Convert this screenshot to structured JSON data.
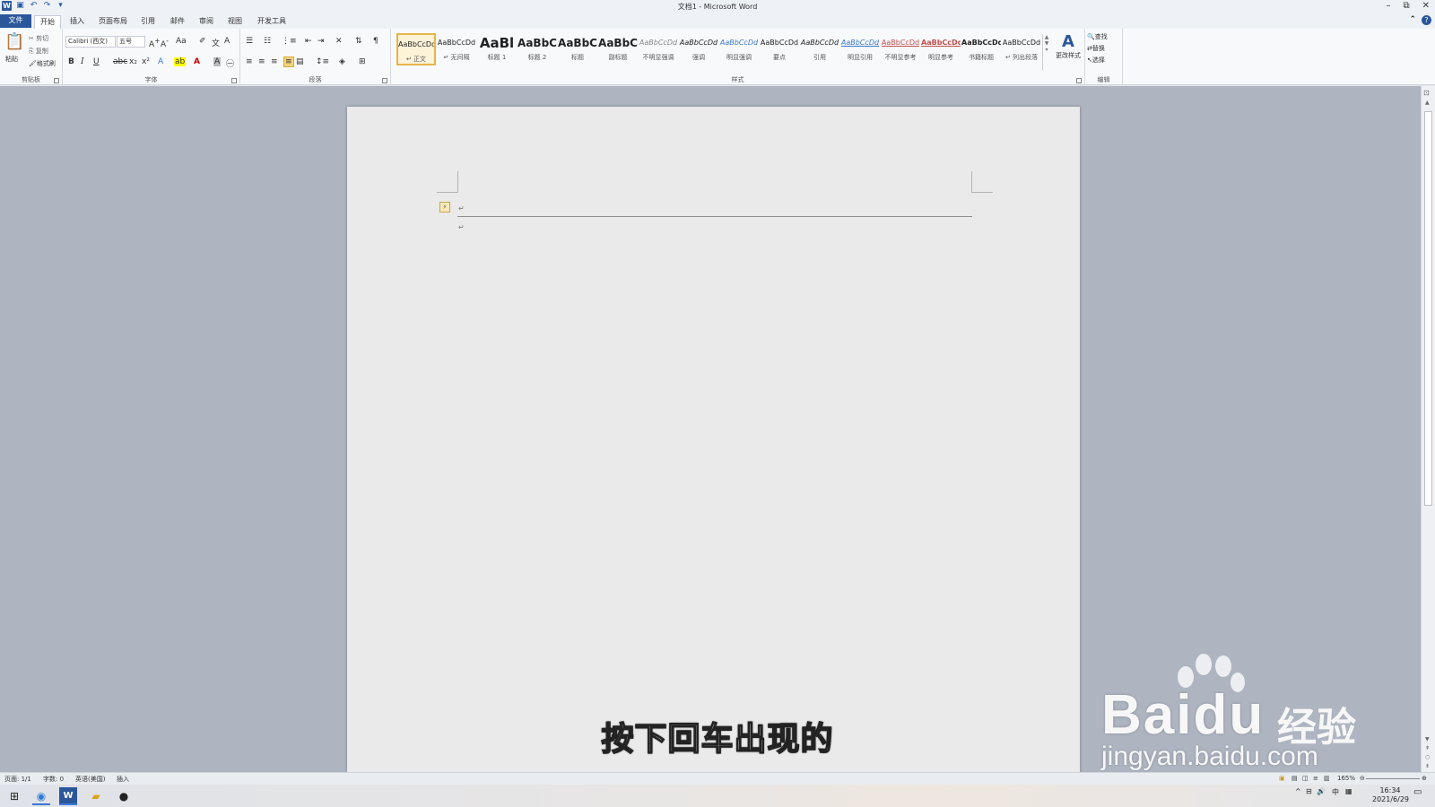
{
  "window": {
    "title": "文档1 - Microsoft Word",
    "controls": [
      "–",
      "⧉",
      "✕"
    ]
  },
  "tabs": [
    "文件",
    "开始",
    "插入",
    "页面布局",
    "引用",
    "邮件",
    "审阅",
    "视图",
    "开发工具"
  ],
  "clipboard": {
    "paste": "粘贴",
    "cut": "剪切",
    "copy": "复制",
    "format_painter": "格式刷",
    "label": "剪贴板"
  },
  "font": {
    "name": "Calibri (西文)",
    "size": "五号",
    "label": "字体"
  },
  "paragraph": {
    "label": "段落"
  },
  "styles": {
    "items": [
      {
        "sample": "AaBbCcDd",
        "name": "↵ 正文",
        "selected": true
      },
      {
        "sample": "AaBbCcDd",
        "name": "↵ 无间隔"
      },
      {
        "sample": "AaBl",
        "name": "标题 1"
      },
      {
        "sample": "AaBbC",
        "name": "标题 2"
      },
      {
        "sample": "AaBbC",
        "name": "标题"
      },
      {
        "sample": "AaBbC",
        "name": "副标题"
      },
      {
        "sample": "AaBbCcDd",
        "name": "不明显强调"
      },
      {
        "sample": "AaBbCcDd",
        "name": "强调"
      },
      {
        "sample": "AaBbCcDd",
        "name": "明显强调"
      },
      {
        "sample": "AaBbCcDd",
        "name": "要点"
      },
      {
        "sample": "AaBbCcDd",
        "name": "引用"
      },
      {
        "sample": "AaBbCcDd",
        "name": "明显引用"
      },
      {
        "sample": "AaBbCcDd",
        "name": "不明显参考"
      },
      {
        "sample": "AaBbCcDd",
        "name": "明显参考"
      },
      {
        "sample": "AaBbCcDd",
        "name": "书籍标题"
      },
      {
        "sample": "AaBbCcDd",
        "name": "↵ 列出段落"
      }
    ],
    "change_styles": "更改样式",
    "label": "样式"
  },
  "editing": {
    "find": "查找",
    "replace": "替换",
    "select": "选择",
    "label": "编辑"
  },
  "document": {
    "paragraph_mark": "↵"
  },
  "status": {
    "page": "页面: 1/1",
    "words": "字数: 0",
    "language": "英语(美国)",
    "mode": "插入",
    "zoom": "165%"
  },
  "subtitle": "按下回车出现的",
  "watermark": {
    "brand": "Baidu",
    "cn": "经验",
    "url": "jingyan.baidu.com"
  },
  "clock": {
    "time": "16:34",
    "date": "2021/6/29"
  },
  "tray": {
    "ime": "中"
  }
}
